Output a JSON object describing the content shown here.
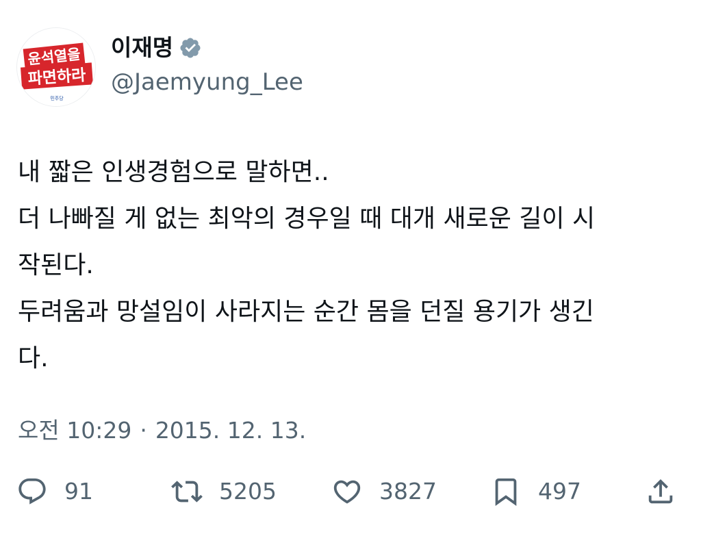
{
  "author": {
    "display_name": "이재명",
    "handle": "@Jaemyung_Lee",
    "verified_icon": "verified-badge-icon",
    "avatar": {
      "line1": "윤석열을",
      "line2": "파면하라",
      "party_mark": "민주당",
      "accent": "#d7262c"
    }
  },
  "tweet": {
    "lines": [
      "내 짧은 인생경험으로 말하면..",
      "더 나빠질 게 없는 최악의 경우일 때 대개 새로운 길이 시",
      "작된다.",
      "두려움과 망설임이 사라지는 순간 몸을 던질 용기가 생긴",
      "다."
    ]
  },
  "meta": {
    "time": "오전 10:29",
    "separator": "·",
    "date": "2015. 12. 13."
  },
  "actions": {
    "reply": {
      "icon": "reply-icon",
      "count": "91"
    },
    "retweet": {
      "icon": "retweet-icon",
      "count": "5205"
    },
    "like": {
      "icon": "heart-icon",
      "count": "3827"
    },
    "bookmark": {
      "icon": "bookmark-icon",
      "count": "497"
    },
    "share": {
      "icon": "share-icon"
    }
  },
  "colors": {
    "text_primary": "#0f1419",
    "text_secondary": "#536471",
    "verified_badge": "#829aab"
  }
}
